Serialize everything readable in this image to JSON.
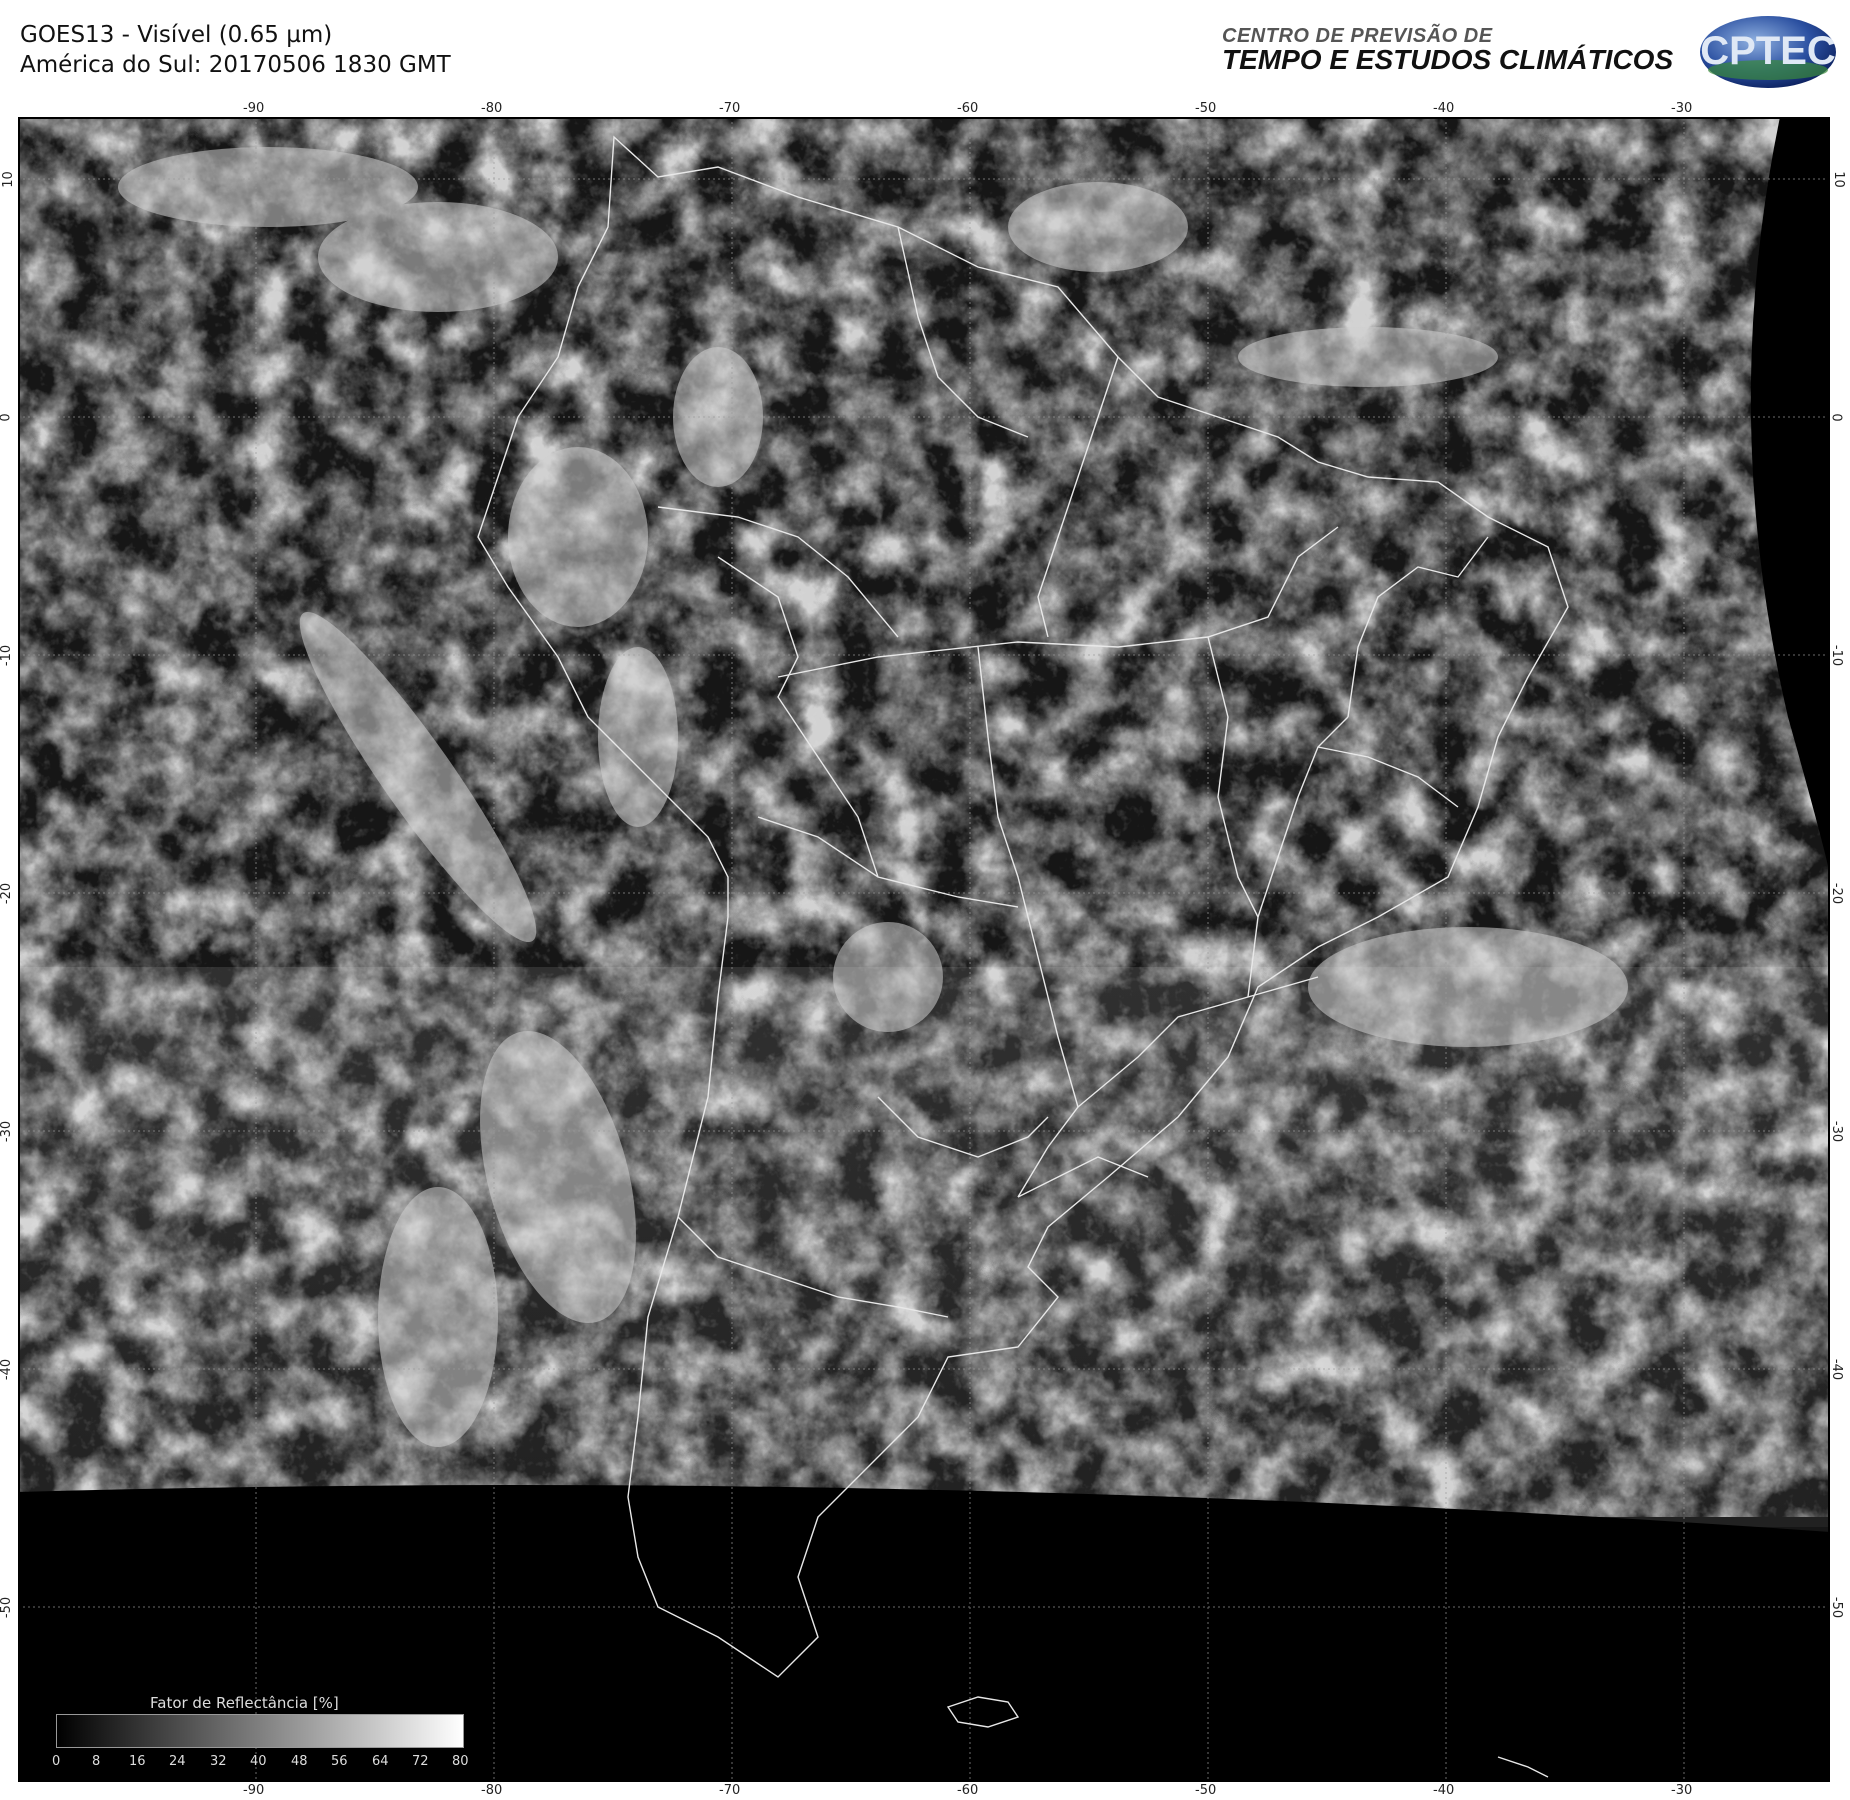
{
  "header": {
    "title_line1": "GOES13 - Visível (0.65 µm)",
    "title_line2": "América do Sul: 20170506 1830 GMT",
    "org_line1": "CENTRO DE PREVISÃO DE",
    "org_line2": "TEMPO E ESTUDOS CLIMÁTICOS",
    "logo_text": "CPTEC"
  },
  "map": {
    "lon_ticks": [
      "-90",
      "-80",
      "-70",
      "-60",
      "-50",
      "-40",
      "-30"
    ],
    "lat_ticks": [
      "10",
      "0",
      "-10",
      "-20",
      "-30",
      "-40",
      "-50"
    ]
  },
  "legend": {
    "title": "Fator de Reflectância [%]",
    "labels": [
      "0",
      "8",
      "16",
      "24",
      "32",
      "40",
      "48",
      "56",
      "64",
      "72",
      "80"
    ]
  }
}
